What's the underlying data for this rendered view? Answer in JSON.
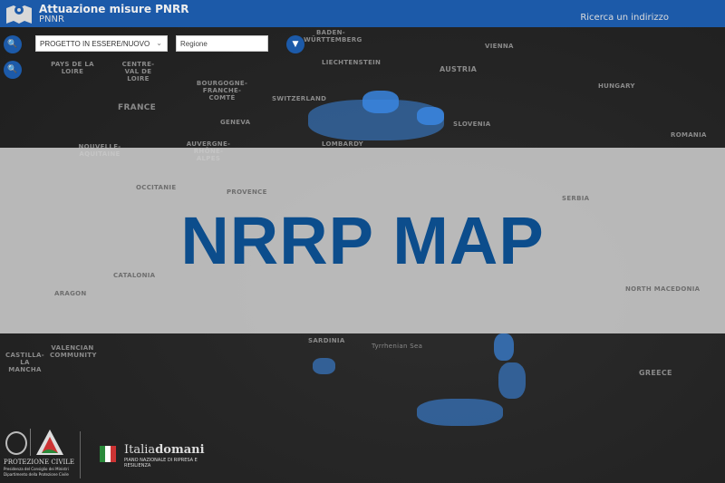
{
  "header": {
    "title": "Attuazione misure PNRR",
    "subtitle": "PNNR",
    "search_address": "Ricerca un indirizzo"
  },
  "controls": {
    "project_filter": "PROGETTO IN ESSERE/NUOVO",
    "region_placeholder": "Regione",
    "zoom_in_icon": "search-plus-icon",
    "zoom_out_icon": "search-minus-icon",
    "filter_icon": "filter-icon"
  },
  "overlay": {
    "title": "NRRP MAP"
  },
  "map_labels": [
    "PAYS DE LA LOIRE",
    "CENTRE-VAL DE LOIRE",
    "FRANCE",
    "BOURGOGNE-FRANCHE-COMTÉ",
    "SWITZERLAND",
    "LIECHTENSTEIN",
    "AUSTRIA",
    "VIENNA",
    "HUNGARY",
    "SLOVENIA",
    "BADEN-WÜRTTEMBERG",
    "NOUVELLE-AQUITAINE",
    "AUVERGNE-RHÔNE-ALPES",
    "OCCITANIE",
    "PROVENCE",
    "CATALONIA",
    "ARAGON",
    "VALENCIAN COMMUNITY",
    "CASTILLA-LA MANCHA",
    "SARDINIA",
    "GREECE",
    "NORTH MACEDONIA",
    "SERBIA",
    "ROMANIA",
    "GENEVA",
    "LOMBARDY",
    "Tyrrhenian Sea"
  ],
  "footer": {
    "protezione": "PROTEZIONE CIVILE",
    "protezione_sub1": "Presidenza del Consiglio dei Ministri",
    "protezione_sub2": "Dipartimento della Protezione Civile",
    "italia_a": "Italia",
    "italia_b": "domani",
    "italia_sub": "PIANO NAZIONALE DI RIPRESA E RESILIENZA"
  },
  "colors": {
    "header": "#1c5aa9",
    "overlay_text": "#0c4d8c",
    "points": "#3a86e0"
  }
}
